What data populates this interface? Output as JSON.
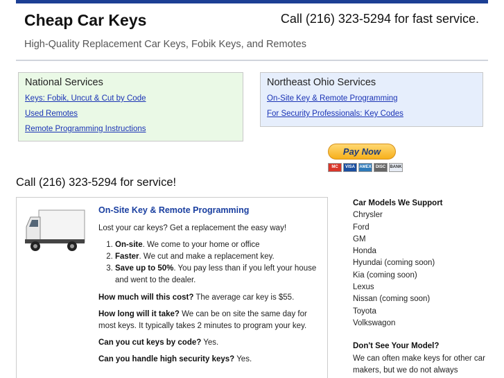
{
  "header": {
    "title": "Cheap Car Keys",
    "phone": "Call (216) 323-5294 for fast service.",
    "tagline": "High-Quality Replacement Car Keys, Fobik Keys, and Remotes"
  },
  "national": {
    "heading": "National Services",
    "links": [
      "Keys: Fobik, Uncut & Cut by Code",
      "Used Remotes",
      "Remote Programming Instructions"
    ]
  },
  "ohio": {
    "heading": "Northeast Ohio Services",
    "links": [
      "On-Site Key & Remote Programming",
      "For Security Professionals: Key Codes"
    ]
  },
  "paypal": {
    "button_label": "Pay Now",
    "cards": [
      "MC",
      "VISA",
      "AMEX",
      "DISC",
      "BANK"
    ]
  },
  "service_heading": "Call (216) 323-5294 for service!",
  "main": {
    "title": "On-Site Key & Remote Programming",
    "intro": "Lost your car keys? Get a replacement the easy way!",
    "list": [
      {
        "bold": "On-site",
        "text": ". We come to your home or office"
      },
      {
        "bold": "Faster",
        "text": ". We cut and make a replacement key."
      },
      {
        "bold": "Save up to 50%",
        "text": ". You pay less than if you left your house and went to the dealer."
      }
    ],
    "faq": [
      {
        "q": "How much will this cost?",
        "a": " The average car key is $55."
      },
      {
        "q": "How long will it take?",
        "a": " We can be on site the same day for most keys. It typically takes 2 minutes to program your key."
      },
      {
        "q": "Can you cut keys by code?",
        "a": " Yes."
      },
      {
        "q": "Can you handle high security keys?",
        "a": " Yes."
      }
    ]
  },
  "sidebar": {
    "models_heading": "Car Models We Support",
    "models": [
      "Chrysler",
      "Ford",
      "GM",
      "Honda",
      "Hyundai (coming soon)",
      "Kia (coming soon)",
      "Lexus",
      "Nissan (coming soon)",
      "Toyota",
      "Volkswagon"
    ],
    "missing_heading": "Don't See Your Model?",
    "missing_text": "We can often make keys for other car makers, but we do not always"
  }
}
